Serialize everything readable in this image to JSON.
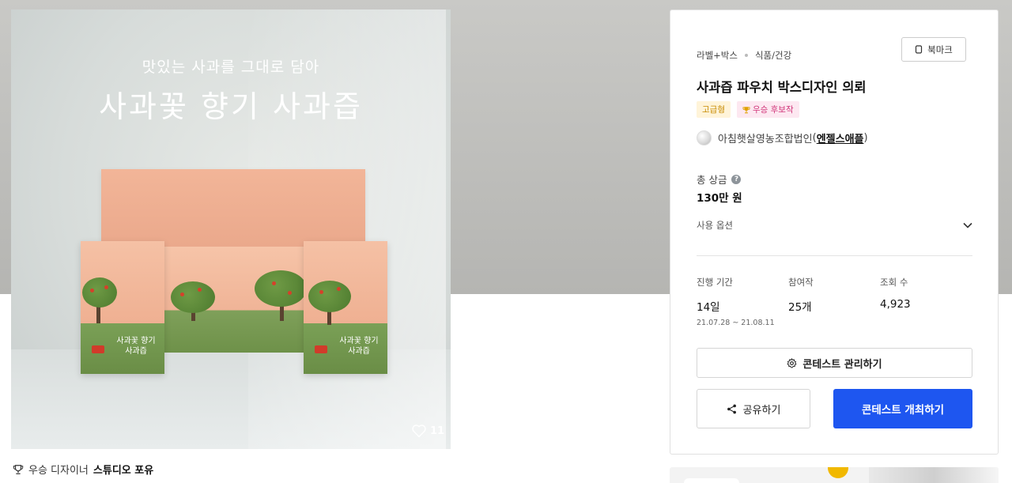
{
  "hero": {
    "subtitle": "맛있는 사과를 그대로 담아",
    "title": "사과꽃 향기 사과즙",
    "pack_text_line1": "사과꽃 향기",
    "pack_text_line2": "사과즙",
    "likes": "11"
  },
  "caption": {
    "prefix": "우승 디자이너",
    "designer": "스튜디오 포유"
  },
  "panel": {
    "category": "라벨+박스",
    "subcategory": "식품/건강",
    "bookmark_label": "북마크",
    "title": "사과즙 파우치 박스디자인 의뢰",
    "badges": {
      "grade": "고급형",
      "award": "우승 후보작"
    },
    "client": {
      "name": "아침햇살영농조합법인",
      "sub": "엔젤스애플",
      "open_paren": "(",
      "close_paren": ")"
    },
    "prize": {
      "label": "총 상금",
      "value": "130만 원"
    },
    "usage_label": "사용 옵션",
    "stats": [
      {
        "label": "진행 기간",
        "value": "14일",
        "dates": "21.07.28 ~ 21.08.11"
      },
      {
        "label": "참여작",
        "value": "25개"
      },
      {
        "label": "조회 수",
        "value": "4,923"
      }
    ],
    "manage_label": "콘테스트 관리하기",
    "share_label": "공유하기",
    "host_label": "콘테스트 개최하기"
  },
  "colors": {
    "accent": "#1e56f0",
    "grade_badge": "#fff4d9",
    "award_badge": "#fde8f1"
  },
  "icons": [
    "bookmark-icon",
    "trophy-icon",
    "help-icon",
    "chevron-down-icon",
    "gear-icon",
    "share-icon",
    "heart-icon"
  ]
}
